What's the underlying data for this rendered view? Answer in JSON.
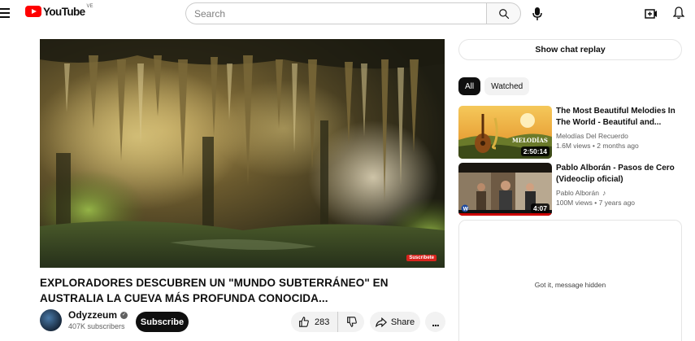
{
  "header": {
    "logo_text": "YouTube",
    "country_code": "VE",
    "search_placeholder": "Search"
  },
  "video": {
    "title": "EXPLORADORES DESCUBREN UN \"MUNDO SUBTERRÁNEO\" EN AUSTRALIA LA CUEVA MÁS PROFUNDA CONOCIDA...",
    "watermark_badge": "Suscríbete",
    "channel_name": "Odyzzeum",
    "subscribers": "407K subscribers",
    "subscribe_label": "Subscribe",
    "like_count": "283",
    "share_label": "Share",
    "more_label": "..."
  },
  "sidebar": {
    "chat_replay_label": "Show chat replay",
    "chips": [
      {
        "label": "All",
        "active": true
      },
      {
        "label": "Watched",
        "active": false
      }
    ],
    "recommendations": [
      {
        "title": "The Most Beautiful Melodies In The World - Beautiful and...",
        "channel": "Melodías Del Recuerdo",
        "views": "1.6M views",
        "age": "2 months ago",
        "duration": "2:50:14",
        "thumb_caption": "MELODÍAS"
      },
      {
        "title": "Pablo Alborán - Pasos de Cero (Videoclip oficial)",
        "channel": "Pablo Alborán",
        "views": "100M views",
        "age": "7 years ago",
        "duration": "4:07"
      }
    ],
    "hidden_message": "Got it, message hidden"
  },
  "colors": {
    "brand_red": "#ff0000",
    "text_primary": "#0f0f0f",
    "text_secondary": "#606060",
    "chip_bg": "#f2f2f2"
  }
}
